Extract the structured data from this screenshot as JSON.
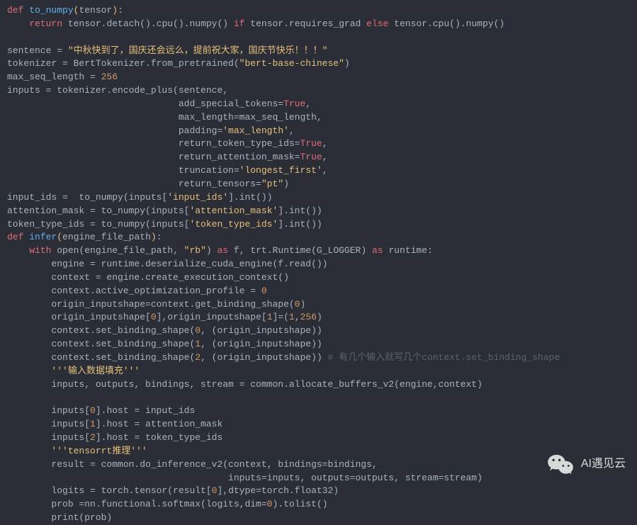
{
  "code": {
    "l1_def": "def",
    "l1_fn": "to_numpy",
    "l1_p1": "(",
    "l1_param": "tensor",
    "l1_p2": ")",
    "l1_colon": ":",
    "l2_return": "return",
    "l2_body1": " tensor.detach().cpu().numpy() ",
    "l2_if": "if",
    "l2_body2": " tensor.requires_grad ",
    "l2_else": "else",
    "l2_body3": " tensor.cpu().numpy()",
    "l4_a": "sentence = ",
    "l4_str": "\"中秋快到了，国庆还会远么，提前祝大家，国庆节快乐！！！\"",
    "l5_a": "tokenizer = BertTokenizer.from_pretrained(",
    "l5_str": "\"bert-base-chinese\"",
    "l5_b": ")",
    "l6_a": "max_seq_length = ",
    "l6_num": "256",
    "l7_a": "inputs = tokenizer.encode_plus(sentence,",
    "l8_a": "                               add_special_tokens=",
    "l8_true": "True",
    "l8_b": ",",
    "l9_a": "                               max_length=max_seq_length,",
    "l10_a": "                               padding=",
    "l10_str": "'max_length'",
    "l10_b": ",",
    "l11_a": "                               return_token_type_ids=",
    "l11_true": "True",
    "l11_b": ",",
    "l12_a": "                               return_attention_mask=",
    "l12_true": "True",
    "l12_b": ",",
    "l13_a": "                               truncation=",
    "l13_str": "'longest_first'",
    "l13_b": ",",
    "l14_a": "                               return_tensors=",
    "l14_str": "\"pt\"",
    "l14_b": ")",
    "l15_a": "input_ids =  to_numpy(inputs[",
    "l15_str": "'input_ids'",
    "l15_b": "].int())",
    "l16_a": "attention_mask = to_numpy(inputs[",
    "l16_str": "'attention_mask'",
    "l16_b": "].int())",
    "l17_a": "token_type_ids = to_numpy(inputs[",
    "l17_str": "'token_type_ids'",
    "l17_b": "].int())",
    "l18_def": "def",
    "l18_fn": "infer",
    "l18_p1": "(",
    "l18_param": "engine_file_path",
    "l18_p2": ")",
    "l18_colon": ":",
    "l19_with": "with",
    "l19_a": " open(engine_file_path, ",
    "l19_str": "\"rb\"",
    "l19_b": ") ",
    "l19_as1": "as",
    "l19_c": " f, trt.Runtime(G_LOGGER) ",
    "l19_as2": "as",
    "l19_d": " runtime:",
    "l20": "        engine = runtime.deserialize_cuda_engine(f.read())",
    "l21": "        context = engine.create_execution_context()",
    "l22_a": "        context.active_optimization_profile = ",
    "l22_num": "0",
    "l23_a": "        origin_inputshape=context.get_binding_shape(",
    "l23_num": "0",
    "l23_b": ")",
    "l24_a": "        origin_inputshape[",
    "l24_n1": "0",
    "l24_b": "],origin_inputshape[",
    "l24_n2": "1",
    "l24_c": "]=(",
    "l24_n3": "1",
    "l24_d": ",",
    "l24_n4": "256",
    "l24_e": ")",
    "l25_a": "        context.set_binding_shape(",
    "l25_n": "0",
    "l25_b": ", (origin_inputshape))",
    "l26_a": "        context.set_binding_shape(",
    "l26_n": "1",
    "l26_b": ", (origin_inputshape))",
    "l27_a": "        context.set_binding_shape(",
    "l27_n": "2",
    "l27_b": ", (origin_inputshape)) ",
    "l27_comment": "# 有几个输入就写几个context.set_binding_shape",
    "l28_str": "'''输入数据填充'''",
    "l29": "        inputs, outputs, bindings, stream = common.allocate_buffers_v2(engine,context)",
    "l31_a": "        inputs[",
    "l31_n": "0",
    "l31_b": "].host = input_ids",
    "l32_a": "        inputs[",
    "l32_n": "1",
    "l32_b": "].host = attention_mask",
    "l33_a": "        inputs[",
    "l33_n": "2",
    "l33_b": "].host = token_type_ids",
    "l34_str": "'''tensorrt推理'''",
    "l35": "        result = common.do_inference_v2(context, bindings=bindings,",
    "l36": "                                        inputs=inputs, outputs=outputs, stream=stream)",
    "l37_a": "        logits = torch.tensor(result[",
    "l37_n": "0",
    "l37_b": "],dtype=torch.float32)",
    "l38_a": "        prob =nn.functional.softmax(logits,dim=",
    "l38_n": "0",
    "l38_b": ").tolist()",
    "l39": "        print(prob)"
  },
  "watermark": {
    "text": "AI遇见云"
  }
}
